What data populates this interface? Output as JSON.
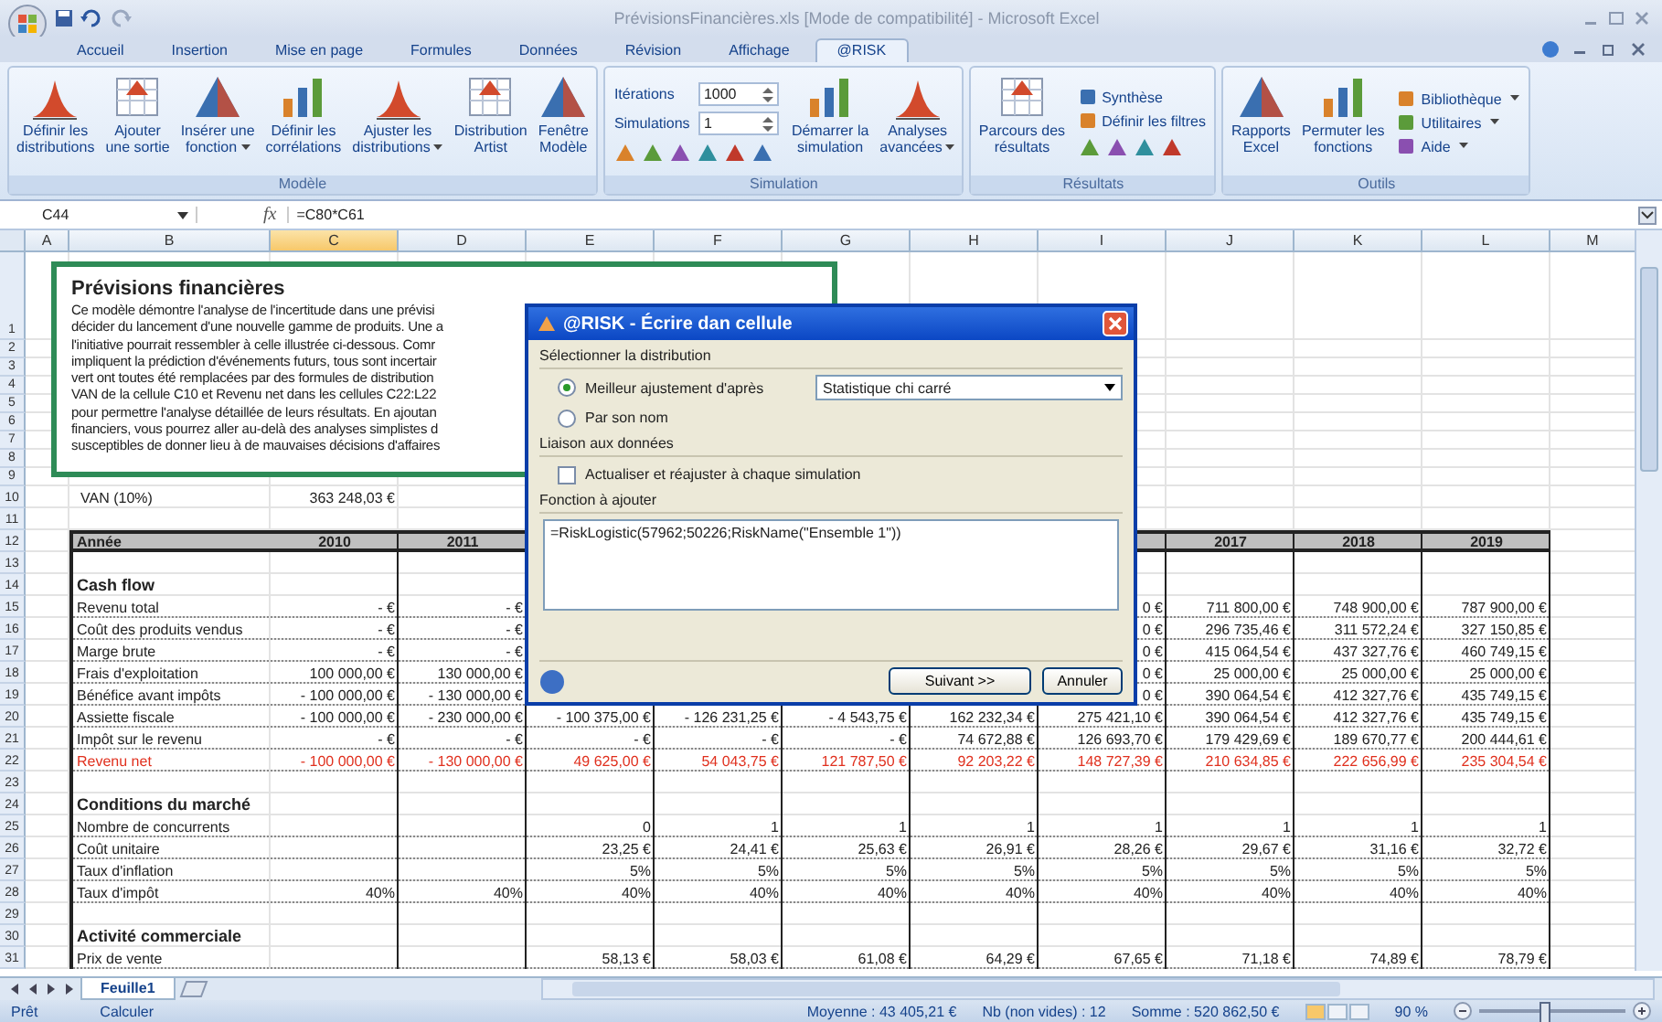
{
  "window": {
    "title": "PrévisionsFinancières.xls  [Mode de compatibilité] - Microsoft Excel"
  },
  "ribbon_tabs": [
    {
      "label": "Accueil",
      "selected": false
    },
    {
      "label": "Insertion",
      "selected": false
    },
    {
      "label": "Mise en page",
      "selected": false
    },
    {
      "label": "Formules",
      "selected": false
    },
    {
      "label": "Données",
      "selected": false
    },
    {
      "label": "Révision",
      "selected": false
    },
    {
      "label": "Affichage",
      "selected": false
    },
    {
      "label": "@RISK",
      "selected": true
    }
  ],
  "ribbon_groups": [
    {
      "label": "Modèle",
      "items": [
        {
          "kind": "large",
          "label": "Définir les\ndistributions",
          "dropdown": false
        },
        {
          "kind": "large",
          "label": "Ajouter\nune sortie",
          "dropdown": false
        },
        {
          "kind": "large",
          "label": "Insérer une\nfonction",
          "dropdown": true
        },
        {
          "kind": "large",
          "label": "Définir les\ncorrélations",
          "dropdown": false
        },
        {
          "kind": "large",
          "label": "Ajuster les\ndistributions",
          "dropdown": true
        },
        {
          "kind": "large",
          "label": "Distribution\nArtist",
          "dropdown": false
        },
        {
          "kind": "large",
          "label": "Fenêtre\nModèle",
          "dropdown": false
        }
      ]
    },
    {
      "label": "Simulation",
      "items": [
        {
          "kind": "spin",
          "label": "Itérations",
          "value": "1000"
        },
        {
          "kind": "spin",
          "label": "Simulations",
          "value": "1"
        },
        {
          "kind": "icons"
        },
        {
          "kind": "large",
          "label": "Démarrer la\nsimulation",
          "dropdown": false
        },
        {
          "kind": "large",
          "label": "Analyses\navancées",
          "dropdown": true
        }
      ]
    },
    {
      "label": "Résultats",
      "items": [
        {
          "kind": "large",
          "label": "Parcours des\nrésultats",
          "dropdown": false
        },
        {
          "kind": "small",
          "label": "Synthèse",
          "dropdown": false
        },
        {
          "kind": "small",
          "label": "Définir les filtres",
          "dropdown": false
        },
        {
          "kind": "icons"
        }
      ]
    },
    {
      "label": "Outils",
      "items": [
        {
          "kind": "large",
          "label": "Rapports\nExcel",
          "dropdown": false
        },
        {
          "kind": "large",
          "label": "Permuter les\nfonctions",
          "dropdown": false
        },
        {
          "kind": "small",
          "label": "Bibliothèque",
          "dropdown": true
        },
        {
          "kind": "small",
          "label": "Utilitaires",
          "dropdown": true
        },
        {
          "kind": "small",
          "label": "Aide",
          "dropdown": true
        }
      ]
    }
  ],
  "formula_bar": {
    "cell": "C44",
    "function_symbol": "fx",
    "formula": "=C80*C61"
  },
  "columns": [
    {
      "label": "A",
      "selected": false
    },
    {
      "label": "B",
      "selected": false
    },
    {
      "label": "C",
      "selected": true
    },
    {
      "label": "D",
      "selected": false
    },
    {
      "label": "E",
      "selected": false
    },
    {
      "label": "F",
      "selected": false
    },
    {
      "label": "G",
      "selected": false
    },
    {
      "label": "H",
      "selected": false
    },
    {
      "label": "I",
      "selected": false
    },
    {
      "label": "J",
      "selected": false
    },
    {
      "label": "K",
      "selected": false
    },
    {
      "label": "L",
      "selected": false
    },
    {
      "label": "M",
      "selected": false
    }
  ],
  "rows": [
    {
      "number": "1",
      "kind": "blank"
    },
    {
      "number": "2",
      "kind": "blank"
    },
    {
      "number": "3",
      "kind": "blank"
    },
    {
      "number": "4",
      "kind": "blank"
    },
    {
      "number": "5",
      "kind": "blank"
    },
    {
      "number": "6",
      "kind": "blank"
    },
    {
      "number": "7",
      "kind": "blank"
    },
    {
      "number": "8",
      "kind": "blank"
    },
    {
      "number": "9",
      "kind": "blank"
    },
    {
      "number": "10",
      "kind": "kpi",
      "cells": [
        "VAN (10%)",
        "363 248,03 €"
      ]
    },
    {
      "number": "11",
      "kind": "blank"
    },
    {
      "number": "12",
      "kind": "header",
      "cells": [
        "Année",
        "2010",
        "2011",
        null,
        null,
        null,
        null,
        null,
        "2017",
        "2018",
        "2019"
      ]
    },
    {
      "number": "13",
      "kind": "gap"
    },
    {
      "number": "14",
      "kind": "section",
      "cells": [
        "Cash flow"
      ]
    },
    {
      "number": "15",
      "kind": "data",
      "cells": [
        "Revenu total",
        "- €",
        "- €",
        null,
        null,
        null,
        null,
        "0 €",
        "711 800,00 €",
        "748 900,00 €",
        "787 900,00 €"
      ]
    },
    {
      "number": "16",
      "kind": "data",
      "cells": [
        "Coût des produits vendus",
        "- €",
        "- €",
        null,
        null,
        null,
        null,
        "0 €",
        "296 735,46 €",
        "311 572,24 €",
        "327 150,85 €"
      ]
    },
    {
      "number": "17",
      "kind": "data",
      "cells": [
        "Marge brute",
        "- €",
        "- €",
        null,
        null,
        null,
        null,
        "0 €",
        "415 064,54 €",
        "437 327,76 €",
        "460 749,15 €"
      ]
    },
    {
      "number": "18",
      "kind": "data",
      "cells": [
        "Frais d'exploitation",
        "100 000,00 €",
        "130 000,00 €",
        null,
        null,
        null,
        null,
        "0 €",
        "25 000,00 €",
        "25 000,00 €",
        "25 000,00 €"
      ]
    },
    {
      "number": "19",
      "kind": "data",
      "cells": [
        "Bénéfice avant impôts",
        "- 100 000,00 €",
        "- 130 000,00 €",
        null,
        null,
        null,
        null,
        "0 €",
        "390 064,54 €",
        "412 327,76 €",
        "435 749,15 €"
      ]
    },
    {
      "number": "20",
      "kind": "data",
      "cells": [
        "Assiette fiscale",
        "- 100 000,00 €",
        "- 230 000,00 €",
        "- 100 375,00 €",
        "- 126 231,25 €",
        "- 4 543,75 €",
        "162 232,34 €",
        "275 421,10 €",
        "390 064,54 €",
        "412 327,76 €",
        "435 749,15 €"
      ]
    },
    {
      "number": "21",
      "kind": "data",
      "cells": [
        "Impôt sur le revenu",
        "- €",
        "- €",
        "- €",
        "- €",
        "- €",
        "74 672,88 €",
        "126 693,70 €",
        "179 429,69 €",
        "189 670,77 €",
        "200 444,61 €"
      ]
    },
    {
      "number": "22",
      "kind": "total",
      "cells": [
        "Revenu net",
        "- 100 000,00 €",
        "- 130 000,00 €",
        "49 625,00 €",
        "54 043,75 €",
        "121 787,50 €",
        "92 203,22 €",
        "148 727,39 €",
        "210 634,85 €",
        "222 656,99 €",
        "235 304,54 €"
      ]
    },
    {
      "number": "23",
      "kind": "gap"
    },
    {
      "number": "24",
      "kind": "section",
      "cells": [
        "Conditions du marché"
      ]
    },
    {
      "number": "25",
      "kind": "data",
      "cells": [
        "Nombre de concurrents",
        null,
        null,
        "0",
        "1",
        "1",
        "1",
        "1",
        "1",
        "1",
        "1"
      ]
    },
    {
      "number": "26",
      "kind": "data",
      "cells": [
        "Coût unitaire",
        null,
        null,
        "23,25 €",
        "24,41 €",
        "25,63 €",
        "26,91 €",
        "28,26 €",
        "29,67 €",
        "31,16 €",
        "32,72 €"
      ]
    },
    {
      "number": "27",
      "kind": "data",
      "cells": [
        "Taux d'inflation",
        null,
        null,
        "5%",
        "5%",
        "5%",
        "5%",
        "5%",
        "5%",
        "5%",
        "5%"
      ]
    },
    {
      "number": "28",
      "kind": "data",
      "cells": [
        "Taux d'impôt",
        "40%",
        "40%",
        "40%",
        "40%",
        "40%",
        "40%",
        "40%",
        "40%",
        "40%",
        "40%"
      ]
    },
    {
      "number": "29",
      "kind": "gap"
    },
    {
      "number": "30",
      "kind": "section",
      "cells": [
        "Activité commerciale"
      ]
    },
    {
      "number": "31",
      "kind": "data",
      "cells": [
        "Prix de vente",
        null,
        null,
        "58,13 €",
        "58,03 €",
        "61,08 €",
        "64,29 €",
        "67,65 €",
        "71,18 €",
        "74,89 €",
        "78,79 €"
      ]
    }
  ],
  "note": {
    "title": "Prévisions financières",
    "lines": [
      "Ce modèle démontre l'analyse de l'incertitude dans une prévisi",
      "décider du lancement d'une nouvelle gamme de produits. Une a",
      "l'initiative pourrait ressembler à celle illustrée ci-dessous. Comr",
      "impliquent la prédiction d'événements futurs, tous sont incertair",
      "vert ont toutes été remplacées par des formules de distribution",
      "VAN de la cellule C10 et Revenu net dans les cellules C22:L22",
      "pour permettre l'analyse détaillée de leurs résultats. En ajoutan",
      "financiers, vous pourrez aller au-delà des analyses simplistes d",
      "susceptibles de donner lieu à de mauvaises décisions d'affaires"
    ]
  },
  "dialog": {
    "title": "@RISK - Écrire dan cellule",
    "distribution_label": "Sélectionner la distribution",
    "options": [
      {
        "label": "Meilleur ajustement d'après",
        "selected": true
      },
      {
        "label": "Par son nom",
        "selected": false
      }
    ],
    "statistic": {
      "value": "Statistique chi carré"
    },
    "link_label": "Liaison aux données",
    "refit": {
      "label": "Actualiser et réajuster à chaque simulation",
      "checked": false
    },
    "function_label": "Fonction à ajouter",
    "function": {
      "value": "=RiskLogistic(57962;50226;RiskName(\"Ensemble 1\"))"
    },
    "buttons": [
      "Suivant >>",
      "Annuler"
    ]
  },
  "sheet_tabs": [
    {
      "label": "Feuille1",
      "selected": true
    }
  ],
  "status": {
    "mode": "Prêt",
    "action": "Calculer",
    "average": "Moyenne : 43 405,21 €",
    "count": "Nb (non vides) : 12",
    "sum": "Somme : 520 862,50 €",
    "zoom": "90 %",
    "view_buttons": [
      {
        "selected": true
      },
      {
        "selected": false
      },
      {
        "selected": false
      }
    ],
    "zoom_slider": {
      "level": 0.45
    }
  }
}
